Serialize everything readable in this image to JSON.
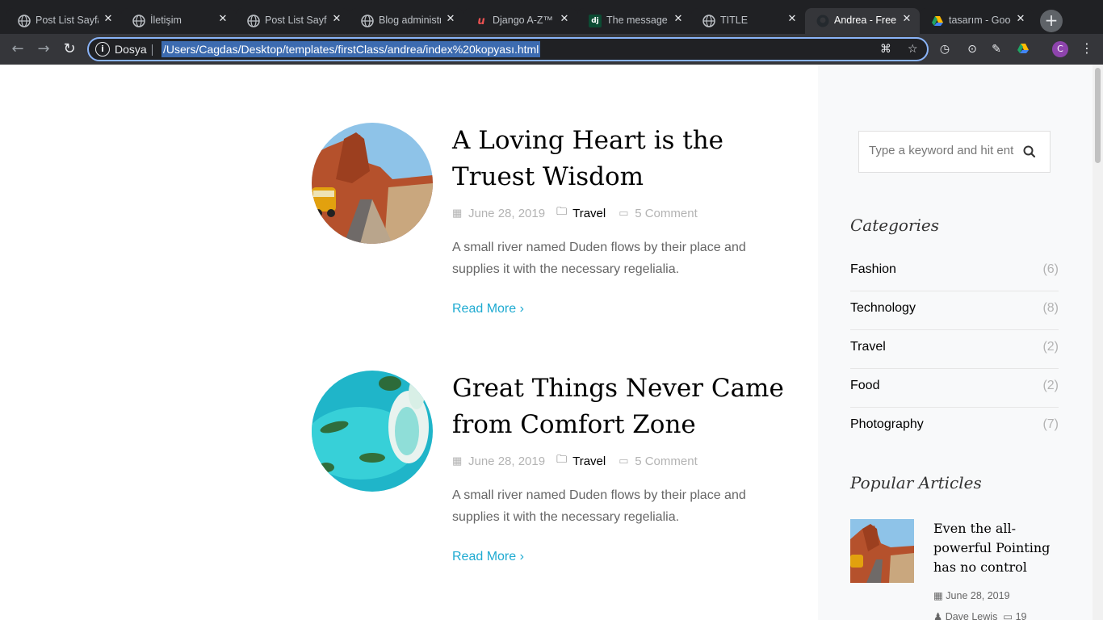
{
  "browser": {
    "tabs": [
      {
        "title": "Post List Sayfası",
        "favicon": "globe-icon"
      },
      {
        "title": "İletişim",
        "favicon": "globe-icon"
      },
      {
        "title": "Post List Sayfası",
        "favicon": "globe-icon"
      },
      {
        "title": "Blog administration",
        "favicon": "globe-icon"
      },
      {
        "title": "Django A-Z™",
        "favicon": "udemy-icon"
      },
      {
        "title": "The message",
        "favicon": "django-icon"
      },
      {
        "title": "TITLE",
        "favicon": "globe-icon"
      },
      {
        "title": "Andrea - Free",
        "favicon": "github-icon",
        "active": true
      },
      {
        "title": "tasarım - Google",
        "favicon": "google-drive-icon"
      }
    ],
    "address": {
      "scheme_label": "Dosya",
      "url": "/Users/Cagdas/Desktop/templates/firstClass/andrea/index%20kopyası.html"
    },
    "avatar_letter": "C"
  },
  "posts": [
    {
      "title": "A Loving Heart is the Truest Wisdom",
      "date": "June 28, 2019",
      "category": "Travel",
      "comments": "5 Comment",
      "excerpt": "A small river named Duden flows by their place and supplies it with the necessary regelialia.",
      "read_more": "Read More"
    },
    {
      "title": "Great Things Never Came from Comfort Zone",
      "date": "June 28, 2019",
      "category": "Travel",
      "comments": "5 Comment",
      "excerpt": "A small river named Duden flows by their place and supplies it with the necessary regelialia.",
      "read_more": "Read More"
    }
  ],
  "sidebar": {
    "search_placeholder": "Type a keyword and hit enter",
    "categories_heading": "Categories",
    "categories": [
      {
        "name": "Fashion",
        "count": "(6)"
      },
      {
        "name": "Technology",
        "count": "(8)"
      },
      {
        "name": "Travel",
        "count": "(2)"
      },
      {
        "name": "Food",
        "count": "(2)"
      },
      {
        "name": "Photography",
        "count": "(7)"
      }
    ],
    "popular_heading": "Popular Articles",
    "popular": [
      {
        "title": "Even the all-powerful Pointing has no control",
        "date": "June 28, 2019",
        "author": "Dave Lewis",
        "comments": "19"
      }
    ]
  },
  "colors": {
    "accent": "#1eaad1",
    "sidebar_bg": "#f8f9fa",
    "browser_dark": "#202124"
  }
}
